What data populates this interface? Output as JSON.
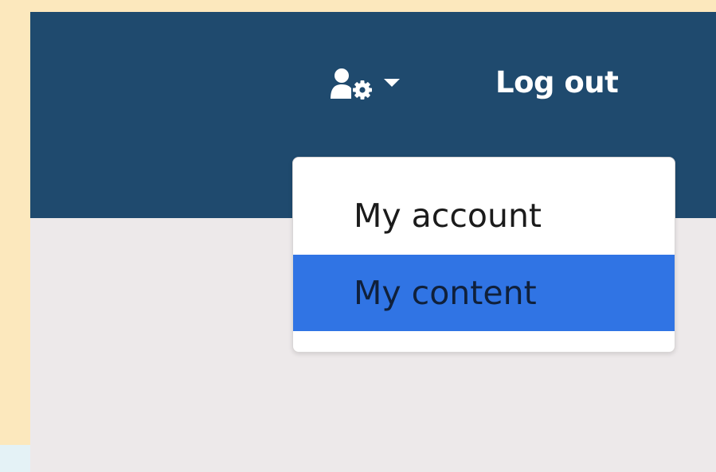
{
  "navbar": {
    "user_menu": {
      "icon": "user-gear-icon",
      "caret_icon": "caret-down-icon",
      "expanded": true
    },
    "logout_label": "Log out"
  },
  "dropdown": {
    "items": [
      {
        "label": "My account",
        "active": false
      },
      {
        "label": "My content",
        "active": true
      }
    ]
  },
  "colors": {
    "navbar_bg": "#1f4a6e",
    "page_bg": "#ede9ea",
    "accent_strip": "#fce8bd",
    "active_item_bg": "#3074e4"
  }
}
